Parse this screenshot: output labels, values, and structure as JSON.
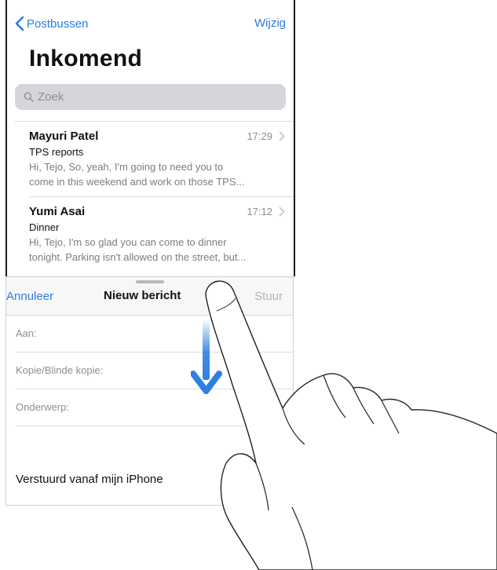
{
  "nav": {
    "back_label": "Postbussen",
    "edit_label": "Wijzig"
  },
  "inbox": {
    "title": "Inkomend",
    "search_placeholder": "Zoek",
    "messages": [
      {
        "sender": "Mayuri Patel",
        "time": "17:29",
        "subject": "TPS reports",
        "preview_line1": "Hi, Tejo, So, yeah, I'm going to need you to",
        "preview_line2": "come in this weekend and work on those TPS..."
      },
      {
        "sender": "Yumi Asai",
        "time": "17:12",
        "subject": "Dinner",
        "preview_line1": "Hi, Tejo, I'm so glad you can come to dinner",
        "preview_line2": "tonight. Parking isn't allowed on the street, but..."
      }
    ]
  },
  "compose": {
    "cancel_label": "Annuleer",
    "title": "Nieuw bericht",
    "send_label": "Stuur",
    "to_label": "Aan:",
    "cc_label": "Kopie/Blinde kopie:",
    "subject_label": "Onderwerp:",
    "signature": "Verstuurd vanaf mijn iPhone"
  },
  "colors": {
    "accent": "#2b7de1",
    "arrow": "#2f7fe0",
    "secondary_text": "#8e8e93",
    "search_bg": "#d6d6da"
  },
  "icons": {
    "back": "chevron-left-icon",
    "search": "magnifier-icon",
    "disclosure": "chevron-right-icon",
    "gesture_arrow": "arrow-down-icon",
    "gesture_hand": "pointing-hand-icon"
  }
}
